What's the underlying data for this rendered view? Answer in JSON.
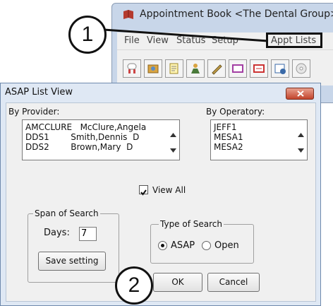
{
  "background_app": {
    "title": "Appointment Book <The Dental Group>",
    "menus": [
      "File",
      "View",
      "Status",
      "Setup",
      "Appt Lists"
    ],
    "toolbar_icons": [
      "tooth-icon",
      "photo-icon",
      "notepad-icon",
      "person-icon",
      "pen-icon",
      "window-icon",
      "card-icon",
      "calendar-icon",
      "cd-icon"
    ]
  },
  "callouts": {
    "one": "1",
    "two": "2"
  },
  "dialog": {
    "title": "ASAP List View",
    "by_provider_label": "By Provider:",
    "providers": [
      {
        "code": "AMCCLURE",
        "name": "McClure,Angela"
      },
      {
        "code": "DDS1",
        "name": "Smith,Dennis  D"
      },
      {
        "code": "DDS2",
        "name": "Brown,Mary  D"
      }
    ],
    "by_operatory_label": "By Operatory:",
    "operatories": [
      "JEFF1",
      "MESA1",
      "MESA2"
    ],
    "view_all_label": "View All",
    "view_all_checked": true,
    "span_group_label": "Span of Search",
    "days_label": "Days:",
    "days_value": "7",
    "save_setting_label": "Save setting",
    "type_group_label": "Type of Search",
    "type_options": [
      {
        "label": "ASAP",
        "selected": true
      },
      {
        "label": "Open",
        "selected": false
      }
    ],
    "ok_label": "OK",
    "cancel_label": "Cancel"
  },
  "colors": {
    "title_bar": "#dfe8f4",
    "close_button": "#c2452c",
    "dialog_body": "#f0f0f0"
  }
}
